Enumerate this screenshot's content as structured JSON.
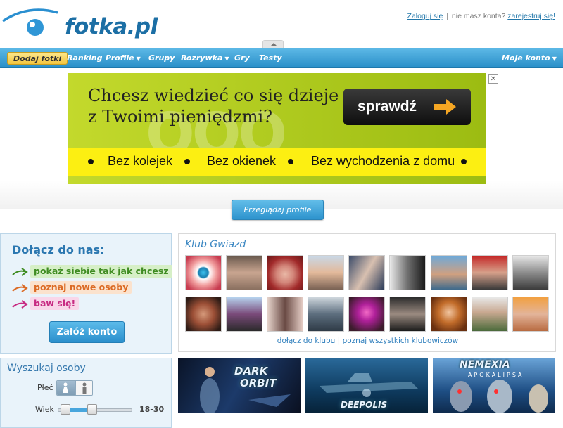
{
  "header": {
    "logo_text": "fotka.pl",
    "login_link": "Zaloguj się",
    "no_account_text": "nie masz konta?",
    "register_link": "zarejestruj się!",
    "separator": "|"
  },
  "nav": {
    "add_photos": "Dodaj fotki",
    "items": [
      "Ranking",
      "Profile",
      "Grupy",
      "Rozrywka",
      "Gry",
      "Testy"
    ],
    "account": "Moje konto",
    "caret": "▼"
  },
  "banner": {
    "headline_line1": "Chcesz wiedzieć co się dzieje",
    "headline_line2": "z Twoimi pieniędzmi?",
    "cta": "sprawdź",
    "points": [
      "Bez kolejek",
      "Bez okienek",
      "Bez wychodzenia z domu"
    ],
    "close_symbol": "✕"
  },
  "browse_profiles": "Przeglądaj profile",
  "join": {
    "title": "Dołącz do nas:",
    "items": [
      "pokaż siebie tak jak chcesz",
      "poznaj nowe osoby",
      "baw się!"
    ],
    "button": "Załóż konto"
  },
  "search": {
    "title": "Wyszukaj osoby",
    "sex_label": "Płeć",
    "age_label": "Wiek",
    "age_range": "18-30"
  },
  "club": {
    "title": "Klub Gwiazd",
    "join_link": "dołącz do klubu",
    "all_link": "poznaj wszystkich klubowiczów",
    "separator": "|"
  },
  "games": [
    {
      "title": "DARK",
      "title2": "ORBIT",
      "subtitle": ""
    },
    {
      "title": "DEEPOLIS",
      "title2": "",
      "subtitle": ""
    },
    {
      "title": "NEMEXIA",
      "title2": "",
      "subtitle": "APOKALIPSA"
    }
  ]
}
